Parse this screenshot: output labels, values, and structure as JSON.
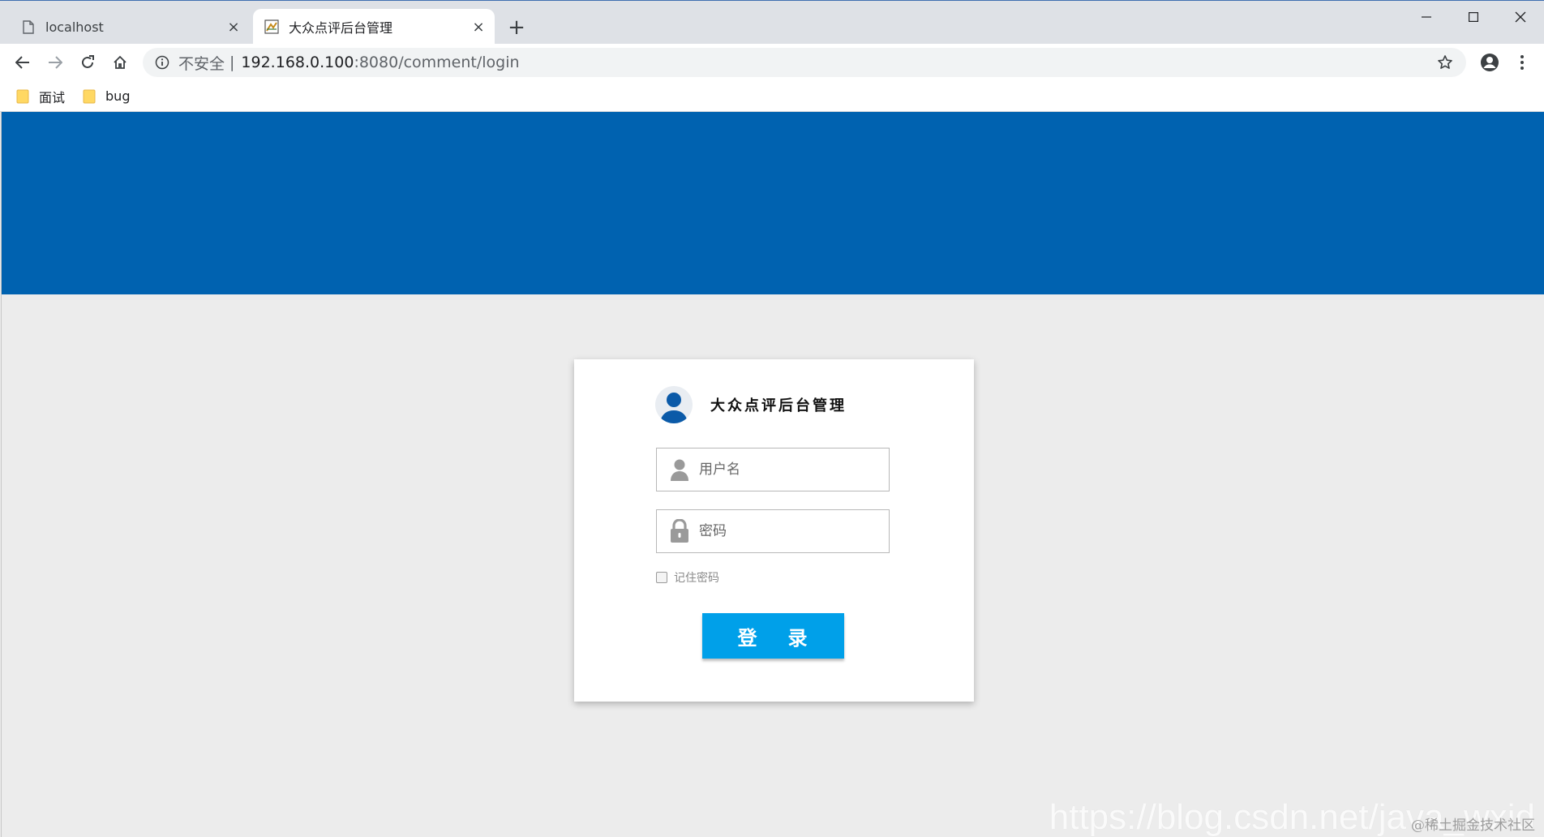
{
  "browser": {
    "tabs": [
      {
        "title": "localhost",
        "active": false,
        "icon": "page-icon"
      },
      {
        "title": "大众点评后台管理",
        "active": true,
        "icon": "site-favicon-icon"
      }
    ],
    "close_glyph": "×",
    "new_tab_glyph": "+",
    "address": {
      "security_label": "不安全",
      "separator": "|",
      "host": "192.168.0.100",
      "path": ":8080/comment/login"
    },
    "bookmarks": [
      {
        "label": "面试",
        "icon": "folder-icon"
      },
      {
        "label": "bug",
        "icon": "folder-icon"
      }
    ]
  },
  "page": {
    "banner_color": "#0062b0",
    "background_color": "#ececec"
  },
  "login": {
    "title": "大众点评后台管理",
    "username_placeholder": "用户名",
    "password_placeholder": "密码",
    "remember_label": "记住密码",
    "login_button": {
      "char1": "登",
      "char2": "录"
    },
    "accent_color": "#00a0e9"
  },
  "watermark": {
    "url_text": "https://blog.csdn.net/java_wxid",
    "community_text": "@稀土掘金技术社区"
  }
}
